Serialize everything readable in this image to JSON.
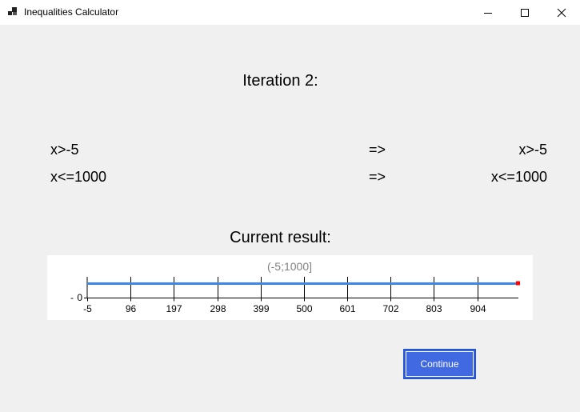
{
  "window": {
    "title": "Inequalities Calculator",
    "controls": [
      "minimize-icon",
      "maximize-icon",
      "close-icon"
    ]
  },
  "iteration": {
    "title": "Iteration 2:",
    "rows": [
      {
        "input": "x>-5",
        "arrow": "=>",
        "output": "x>-5"
      },
      {
        "input": "x<=1000",
        "arrow": "=>",
        "output": "x<=1000"
      }
    ]
  },
  "result": {
    "title": "Current result:"
  },
  "chart_data": {
    "type": "line",
    "title": "(-5;1000]",
    "interval": {
      "from": -5,
      "to": 1000,
      "left_closed": false,
      "right_closed": true
    },
    "x_ticks": [
      "-5",
      "96",
      "197",
      "298",
      "399",
      "500",
      "601",
      "702",
      "803",
      "904"
    ],
    "x_tick_values": [
      -5,
      96,
      197,
      298,
      399,
      500,
      601,
      702,
      803,
      904
    ],
    "y_ticks": [
      "0"
    ],
    "xlim": [
      -5,
      1000
    ],
    "line_color": "#3c86e6",
    "endpoint_color": "#ff0000",
    "title_color": "#808080"
  },
  "actions": {
    "continue_label": "Continue",
    "accent": "#4169e1"
  }
}
